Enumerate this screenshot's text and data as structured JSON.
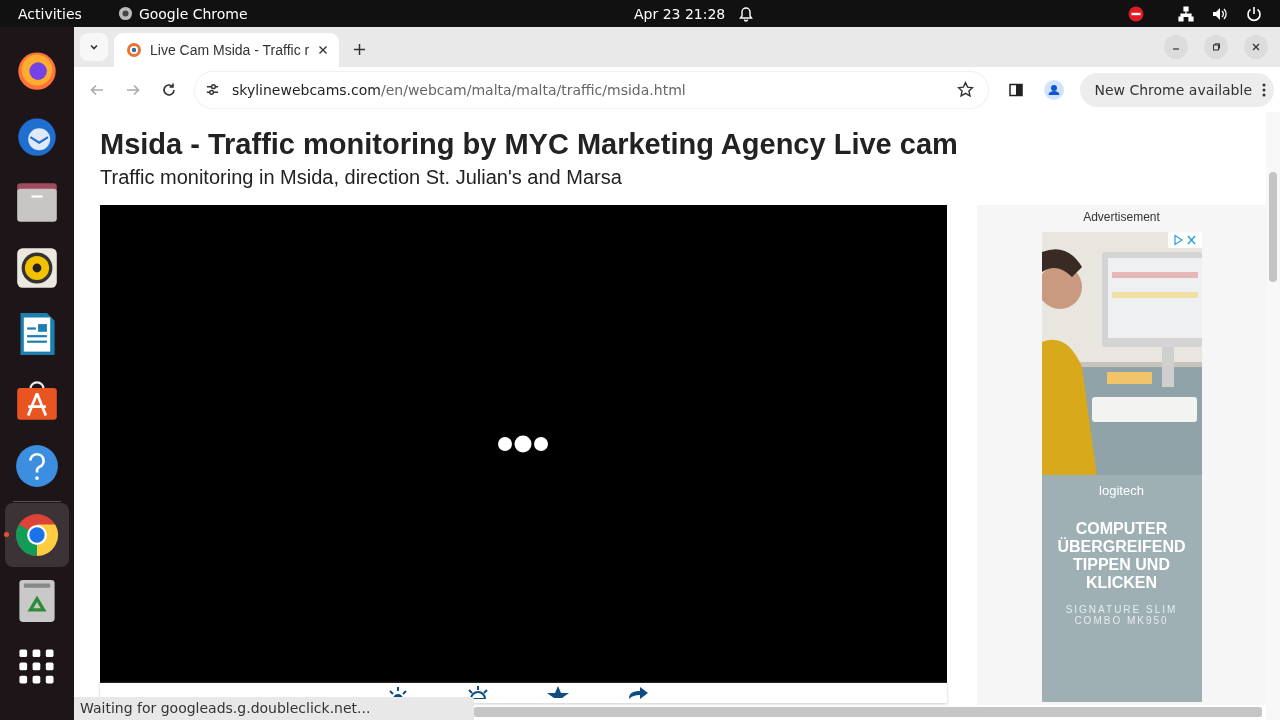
{
  "topbar": {
    "activities": "Activities",
    "app": "Google Chrome",
    "clock": "Apr 23  21:28"
  },
  "dock": [
    {
      "kind": "firefox",
      "selected": false
    },
    {
      "kind": "thunderbird",
      "selected": false
    },
    {
      "kind": "files",
      "selected": false
    },
    {
      "kind": "rhythmbox",
      "selected": false
    },
    {
      "kind": "writer",
      "selected": false
    },
    {
      "kind": "appcenter",
      "selected": false
    },
    {
      "kind": "help",
      "selected": false
    },
    {
      "kind": "chrome",
      "selected": true
    },
    {
      "kind": "trash",
      "selected": false
    },
    {
      "kind": "apps",
      "selected": false
    }
  ],
  "tabs": [
    {
      "title": "Live Cam Msida - Traffic r",
      "selected": true
    }
  ],
  "address": {
    "domain": "skylinewebcams.com",
    "path": "/en/webcam/malta/malta/traffic/msida.html"
  },
  "update_button": "New Chrome available",
  "page": {
    "title": "Msida - Traffic monitoring by MYC Marketing Agency Live cam",
    "subtitle": "Traffic monitoring in Msida, direction St. Julian's and Marsa"
  },
  "ad": {
    "label": "Advertisement",
    "brand": "logitech",
    "headline": "COMPUTER ÜBERGREIFEND TIPPEN UND KLICKEN",
    "product": "SIGNATURE SLIM COMBO MK950"
  },
  "status_bar": "Waiting for googleads.g.doubleclick.net..."
}
